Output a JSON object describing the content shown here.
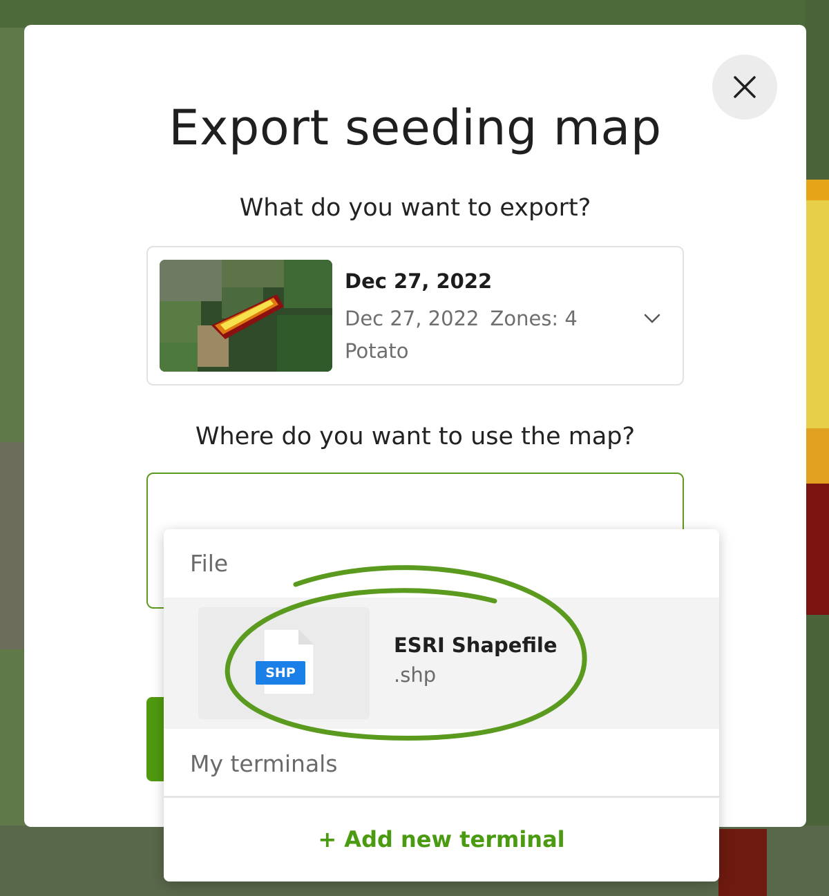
{
  "modal": {
    "title": "Export seeding map",
    "question_export": "What do you want to export?",
    "question_use": "Where do you want to use the map?"
  },
  "selected_map": {
    "title": "Dec 27, 2022",
    "date": "Dec 27, 2022",
    "zones": "Zones: 4",
    "crop": "Potato"
  },
  "dropdown": {
    "section_file": "File",
    "options": [
      {
        "badge": "SHP",
        "title": "ESRI Shapefile",
        "extension": ".shp"
      }
    ],
    "section_terminals": "My terminals",
    "add_terminal": "+ Add new terminal"
  },
  "icons": {
    "close": "close-icon",
    "chevron": "chevron-down-icon",
    "file": "file-icon"
  },
  "colors": {
    "accent_green": "#4f9a0f",
    "file_badge_blue": "#1a7fe6",
    "annotation_green": "#5a9a1e"
  }
}
